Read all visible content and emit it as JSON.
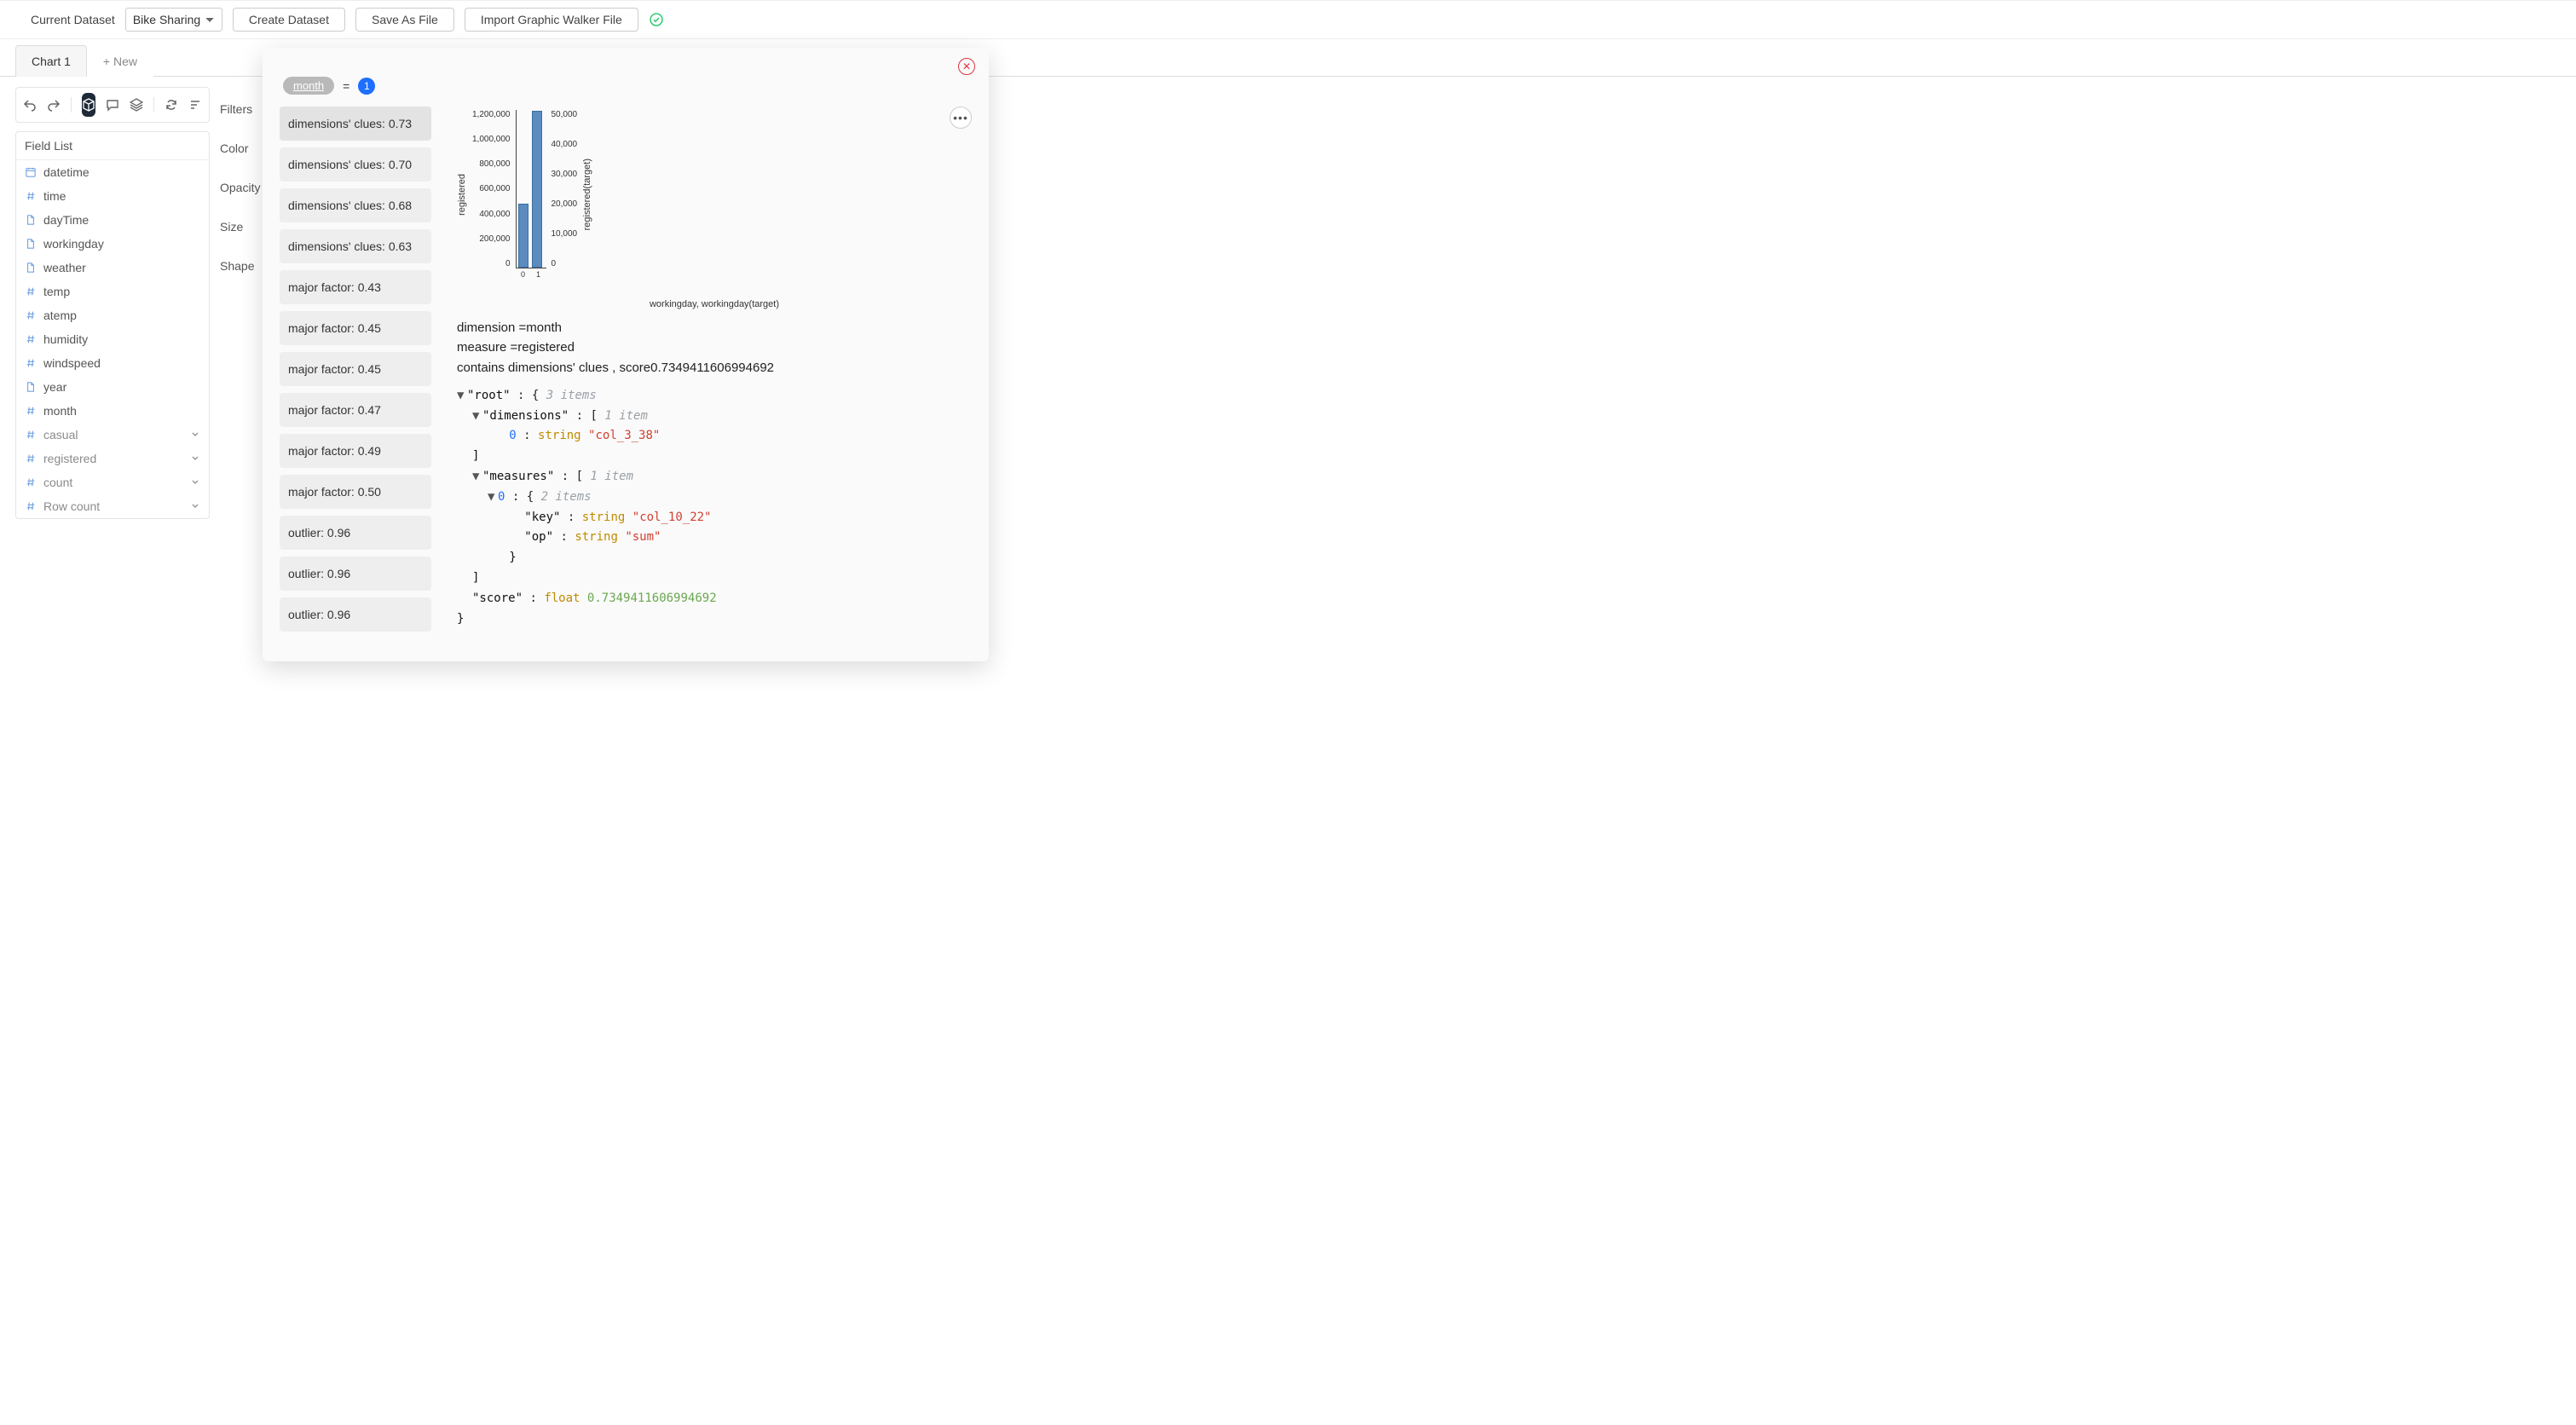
{
  "topbar": {
    "current_dataset_label": "Current Dataset",
    "dataset_value": "Bike Sharing",
    "create_btn": "Create Dataset",
    "save_btn": "Save As File",
    "import_btn": "Import Graphic Walker File"
  },
  "tabs": {
    "active": "Chart 1",
    "new": "+ New"
  },
  "field_panel": {
    "title": "Field List",
    "fields": [
      {
        "icon": "calendar",
        "label": "datetime"
      },
      {
        "icon": "hash",
        "label": "time"
      },
      {
        "icon": "doc",
        "label": "dayTime"
      },
      {
        "icon": "doc",
        "label": "workingday"
      },
      {
        "icon": "doc",
        "label": "weather"
      },
      {
        "icon": "hash",
        "label": "temp"
      },
      {
        "icon": "hash",
        "label": "atemp"
      },
      {
        "icon": "hash",
        "label": "humidity"
      },
      {
        "icon": "hash",
        "label": "windspeed"
      },
      {
        "icon": "doc",
        "label": "year"
      },
      {
        "icon": "hash",
        "label": "month"
      },
      {
        "icon": "hash",
        "label": "casual",
        "muted": true,
        "chev": true
      },
      {
        "icon": "hash",
        "label": "registered",
        "muted": true,
        "chev": true
      },
      {
        "icon": "hash",
        "label": "count",
        "muted": true,
        "chev": true
      },
      {
        "icon": "hash",
        "label": "Row count",
        "muted": true,
        "chev": true
      }
    ]
  },
  "shelves": {
    "filters": "Filters",
    "color": "Color",
    "opacity": "Opacity",
    "size": "Size",
    "shape": "Shape"
  },
  "modal": {
    "crumb": {
      "pill": "month",
      "eq": "=",
      "badge": "1"
    },
    "clues": [
      "dimensions' clues: 0.73",
      "dimensions' clues: 0.70",
      "dimensions' clues: 0.68",
      "dimensions' clues: 0.63",
      "major factor: 0.43",
      "major factor: 0.45",
      "major factor: 0.45",
      "major factor: 0.47",
      "major factor: 0.49",
      "major factor: 0.50",
      "outlier: 0.96",
      "outlier: 0.96",
      "outlier: 0.96"
    ],
    "desc": {
      "line1": "dimension =month",
      "line2": "measure =registered",
      "line3": "contains dimensions' clues ,   score0.7349411606994692"
    },
    "json": {
      "root_label": "\"root\"",
      "root_meta": "3 items",
      "dimensions_label": "\"dimensions\"",
      "dimensions_meta": "1 item",
      "dim0_val": "\"col_3_38\"",
      "measures_label": "\"measures\"",
      "measures_meta": "1 item",
      "m0_meta": "2 items",
      "m0_key_label": "\"key\"",
      "m0_key_val": "\"col_10_22\"",
      "m0_op_label": "\"op\"",
      "m0_op_val": "\"sum\"",
      "score_label": "\"score\"",
      "score_val": "0.7349411606994692",
      "type_string": "string",
      "type_float": "float"
    }
  },
  "chart_data": {
    "type": "bar",
    "title": "",
    "xlabel": "workingday, workingday(target)",
    "ylabel_left": "registered",
    "ylabel_right": "registered(target)",
    "categories": [
      "0",
      "1"
    ],
    "series": [
      {
        "name": "registered",
        "values": [
          500000,
          1230000
        ]
      },
      {
        "name": "registered(target)",
        "values": [
          20000,
          50000
        ]
      }
    ],
    "yticks_left": [
      "1,200,000",
      "1,000,000",
      "800,000",
      "600,000",
      "400,000",
      "200,000",
      "0"
    ],
    "yticks_right": [
      "50,000",
      "40,000",
      "30,000",
      "20,000",
      "10,000",
      "0"
    ],
    "ylim_left": [
      0,
      1200000
    ],
    "ylim_right": [
      0,
      50000
    ]
  }
}
